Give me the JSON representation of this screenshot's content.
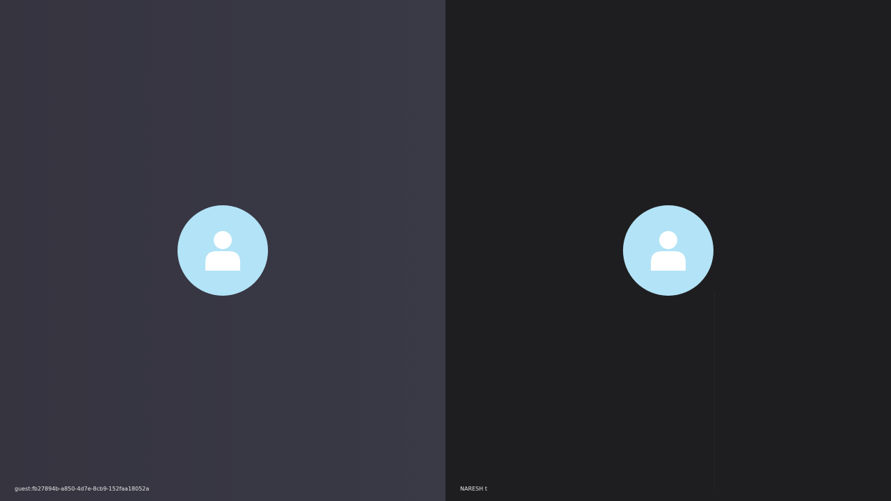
{
  "participants": [
    {
      "display_name": "guest:fb27894b-a850-4d7e-8cb9-152faa18052a",
      "avatar_icon": "user-silhouette-icon",
      "tile_color": "#383744"
    },
    {
      "display_name": "NARESH t",
      "avatar_icon": "user-silhouette-icon",
      "tile_color": "#1e1e20"
    }
  ],
  "colors": {
    "avatar_circle": "#b3e3f6",
    "avatar_figure": "#ffffff",
    "label_text": "#e6e6e6"
  }
}
